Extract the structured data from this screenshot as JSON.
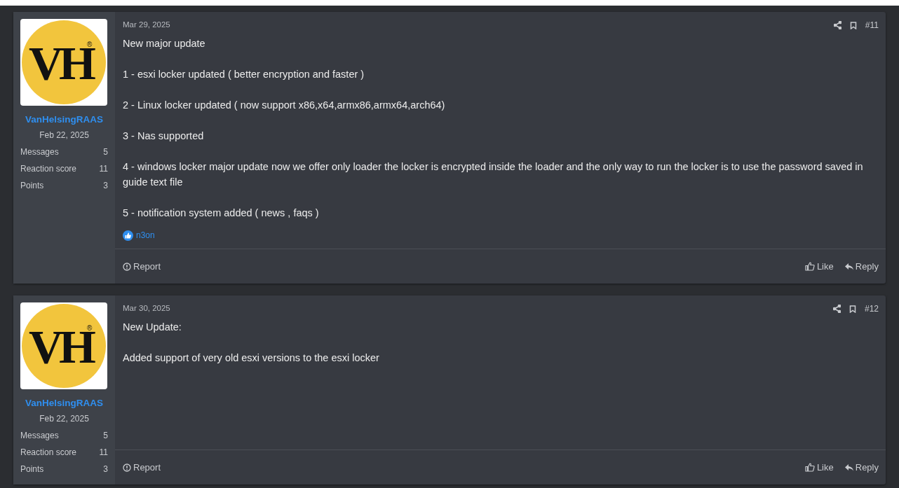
{
  "posts": [
    {
      "author": {
        "logo_text": "VH",
        "logo_mark": "®",
        "name": "VanHelsingRAAS",
        "joined": "Feb 22, 2025",
        "stats": [
          {
            "label": "Messages",
            "value": "5"
          },
          {
            "label": "Reaction score",
            "value": "11"
          },
          {
            "label": "Points",
            "value": "3"
          }
        ]
      },
      "date": "Mar 29, 2025",
      "number": "#11",
      "paragraphs": [
        "New major update",
        "1 - esxi locker updated ( better encryption and faster )",
        "2 - Linux locker updated ( now support x86,x64,armx86,armx64,arch64)",
        "3 - Nas supported",
        "4 - windows locker major update now we offer only loader the locker is encrypted inside the loader and the only way to run the locker is to use the password saved in guide text file",
        "5 - notification system added ( news , faqs )"
      ],
      "reactions": [
        {
          "user": "n3on"
        }
      ],
      "actions": {
        "report": "Report",
        "like": "Like",
        "reply": "Reply"
      }
    },
    {
      "author": {
        "logo_text": "VH",
        "logo_mark": "®",
        "name": "VanHelsingRAAS",
        "joined": "Feb 22, 2025",
        "stats": [
          {
            "label": "Messages",
            "value": "5"
          },
          {
            "label": "Reaction score",
            "value": "11"
          },
          {
            "label": "Points",
            "value": "3"
          }
        ]
      },
      "date": "Mar 30, 2025",
      "number": "#12",
      "paragraphs": [
        "New Update:",
        "Added support of very old esxi versions to the esxi locker"
      ],
      "actions": {
        "report": "Report",
        "like": "Like",
        "reply": "Reply"
      }
    }
  ]
}
